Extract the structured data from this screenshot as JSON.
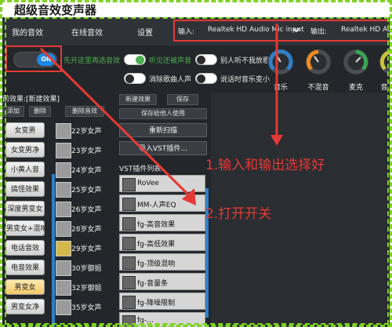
{
  "window": {
    "title": "超级音效变声器"
  },
  "nav": {
    "items": [
      "我的音效",
      "在线音效",
      "设置"
    ],
    "input_label": "输入:",
    "input_value": "Realtek HD Audio Mic input",
    "output_label": "输出:",
    "output_value": "Realtek HD Au"
  },
  "main_toggle": {
    "state": "ON",
    "hint": "先开这里再选音效"
  },
  "options": [
    {
      "label": "听见还被声音",
      "on": true
    },
    {
      "label": "别人听不我放歌",
      "on": false
    },
    {
      "label": "消除歌曲人声",
      "on": false
    },
    {
      "label": "说话时音乐变小",
      "on": false
    }
  ],
  "gauges": [
    "音乐",
    "不混音",
    "麦克",
    "音"
  ],
  "current_effect": {
    "label": "前效果:[新建效果]",
    "add": "添加",
    "delete": "删除",
    "delete_effect": "删除音效"
  },
  "effect_categories": [
    {
      "label": "女变男",
      "active": false
    },
    {
      "label": "女变男净",
      "active": false
    },
    {
      "label": "小黄人音",
      "active": false
    },
    {
      "label": "搞怪效果",
      "active": false
    },
    {
      "label": "深度男变女",
      "active": false
    },
    {
      "label": "男变女+混响",
      "active": false
    },
    {
      "label": "电话音效",
      "active": false
    },
    {
      "label": "电音效果",
      "active": false
    },
    {
      "label": "男变女",
      "active": true
    },
    {
      "label": "男变女净",
      "active": false
    }
  ],
  "voice_items": [
    {
      "label": "22岁女声",
      "gold": false
    },
    {
      "label": "23岁女声",
      "gold": false
    },
    {
      "label": "24岁女声",
      "gold": false
    },
    {
      "label": "25岁女声",
      "gold": false
    },
    {
      "label": "26岁女声",
      "gold": false
    },
    {
      "label": "28岁女声",
      "gold": false
    },
    {
      "label": "29岁女声",
      "gold": true
    },
    {
      "label": "30岁御姐",
      "gold": false
    },
    {
      "label": "32岁御姐",
      "gold": false
    },
    {
      "label": "35岁女声",
      "gold": false
    }
  ],
  "actions": {
    "new_effect": "新建效果",
    "save": "保存",
    "save_for_others": "保存给他人使用",
    "rescan": "重新扫描",
    "import_vst": "导入VST插件...",
    "vst_list_label": "VST插件列表:"
  },
  "vst_plugins": [
    "RoVee",
    "MM-人声EQ",
    "fg-高音效果",
    "fg-高低效果",
    "fg-顶级混响",
    "fg-音量条",
    "fg-降噪限制",
    "fg-..."
  ],
  "annotations": {
    "step1": "1.输入和输出选择好",
    "step2": "2.打开开关"
  },
  "colors": {
    "accent": "#1e88e5",
    "annotation": "#e53935",
    "guide_dash": "#7ed321",
    "hint_text": "#4caf50"
  }
}
